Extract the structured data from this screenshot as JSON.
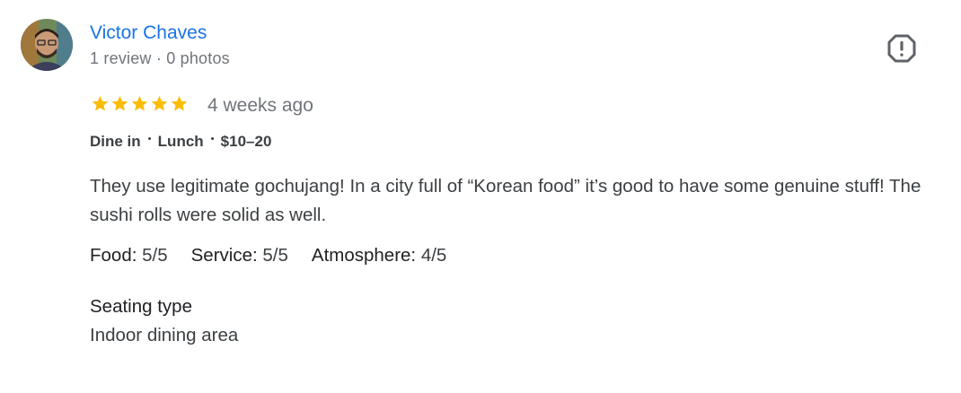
{
  "reviewer": {
    "name": "Victor Chaves",
    "meta": "1 review · 0 photos"
  },
  "review": {
    "rating": 5,
    "rating_max": 5,
    "star_color": "#fbbc04",
    "date": "4 weeks ago",
    "tags": [
      "Dine in",
      "Lunch",
      "$10–20"
    ],
    "text": "They use legitimate gochujang! In a city full of “Korean food” it’s good to have some genuine stuff! The sushi rolls were solid as well.",
    "sub_ratings": [
      {
        "label": "Food:",
        "value": "5/5"
      },
      {
        "label": "Service:",
        "value": "5/5"
      },
      {
        "label": "Atmosphere:",
        "value": "4/5"
      }
    ],
    "seating_label": "Seating type",
    "seating_value": "Indoor dining area"
  },
  "icons": {
    "report": "report-flag-icon",
    "star": "star-icon"
  },
  "colors": {
    "name_link": "#1a73e8",
    "secondary_text": "#70757a",
    "body_text": "#3c4043"
  }
}
